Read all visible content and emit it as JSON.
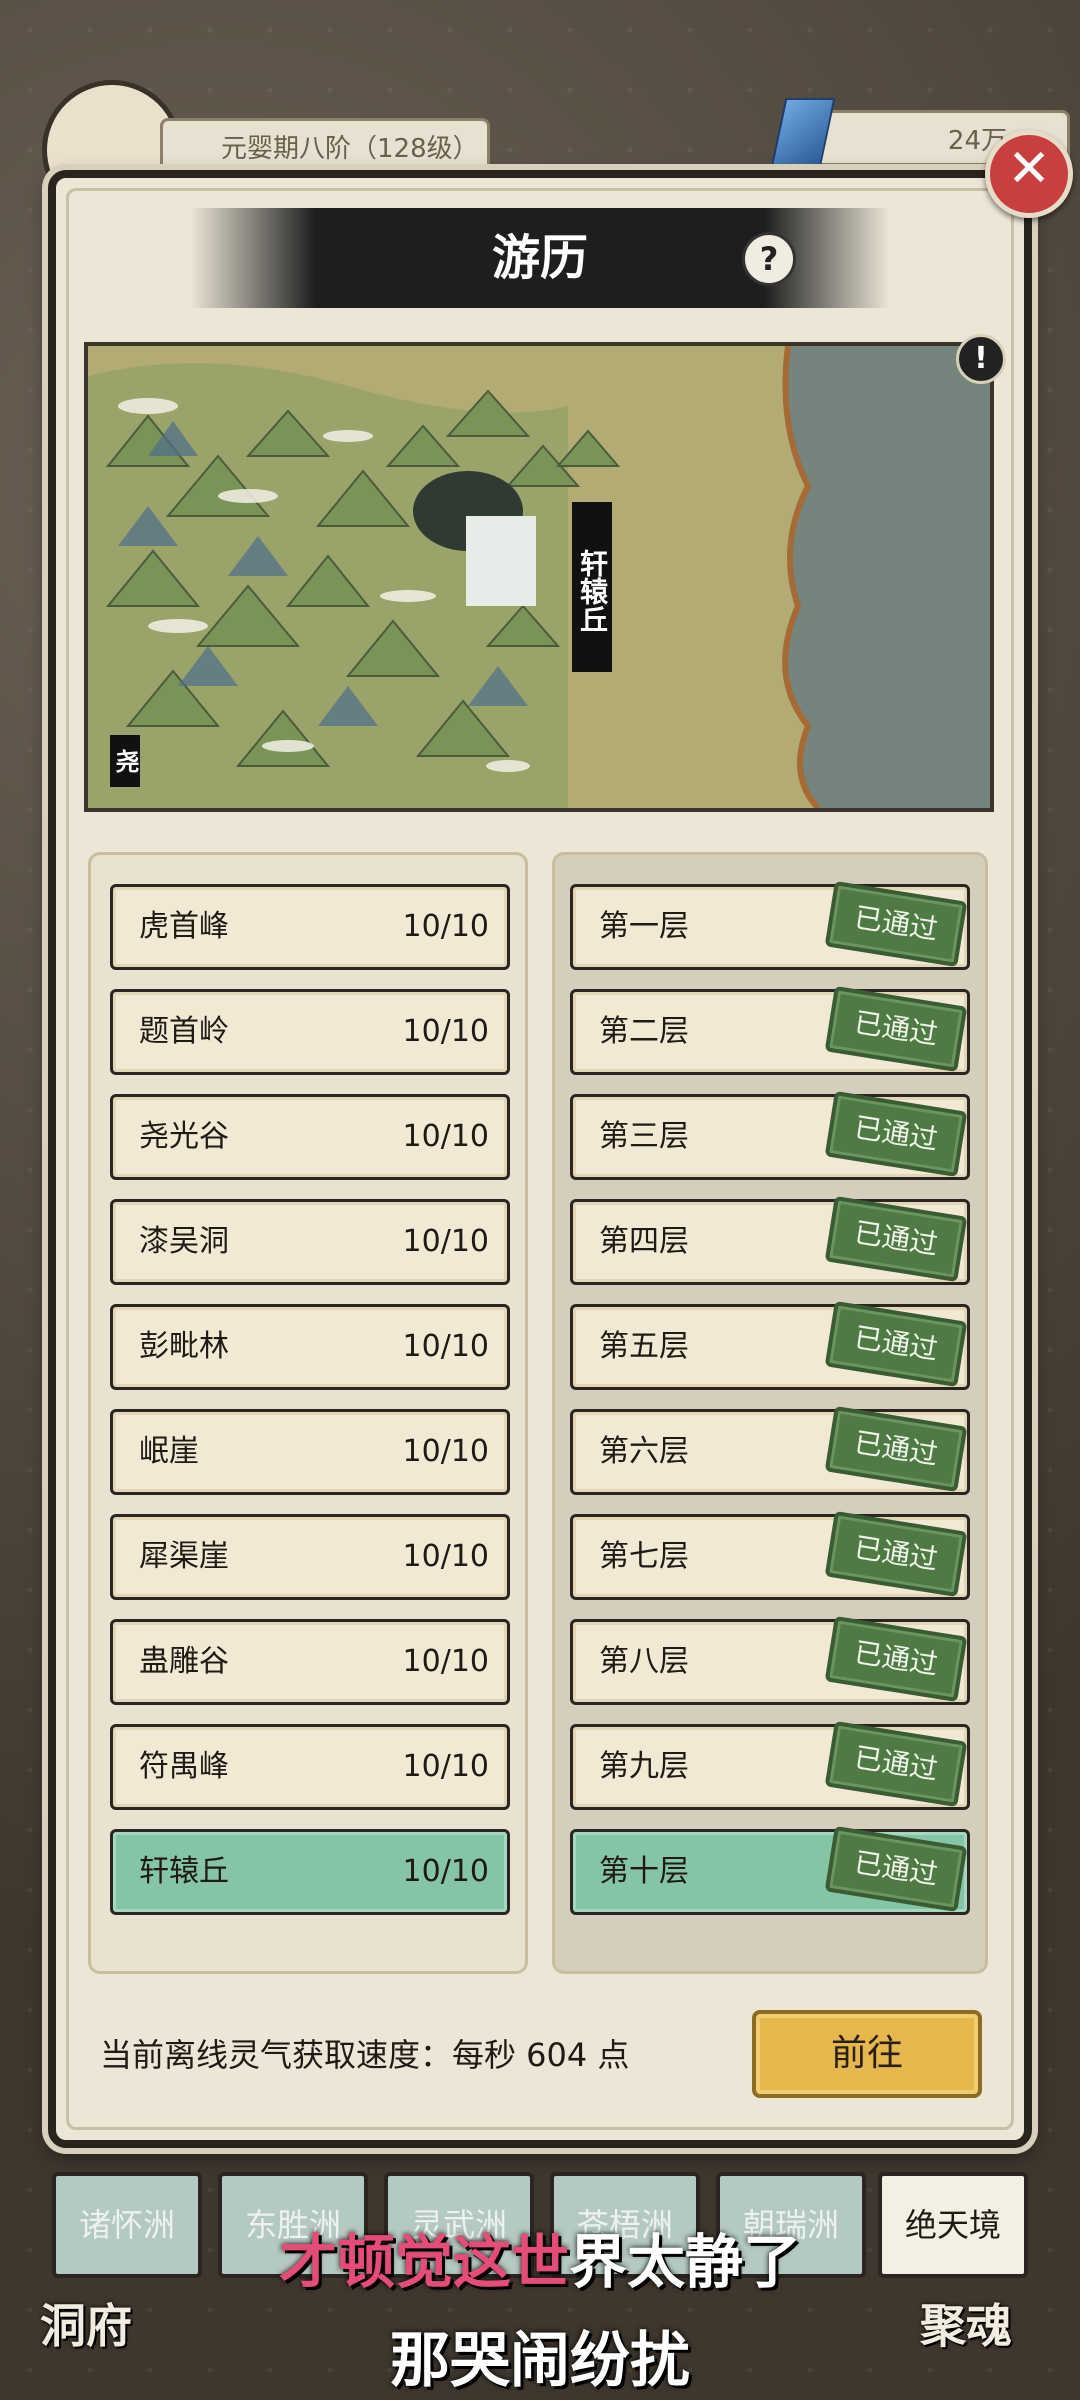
{
  "hud": {
    "level_text": "元婴期八阶（128级）",
    "currency_text": "24万",
    "icons": [
      "avatar",
      "gem-icon"
    ]
  },
  "dialog": {
    "title": "游历",
    "help_label": "?",
    "close_label": "✕",
    "alert_label": "!"
  },
  "map": {
    "label": "轩辕丘",
    "corner_label": "尧"
  },
  "regions": [
    {
      "name": "虎首峰",
      "progress": "10/10"
    },
    {
      "name": "题首岭",
      "progress": "10/10"
    },
    {
      "name": "尧光谷",
      "progress": "10/10"
    },
    {
      "name": "漆吴洞",
      "progress": "10/10"
    },
    {
      "name": "彭毗林",
      "progress": "10/10"
    },
    {
      "name": "岷崖",
      "progress": "10/10"
    },
    {
      "name": "犀渠崖",
      "progress": "10/10"
    },
    {
      "name": "蛊雕谷",
      "progress": "10/10"
    },
    {
      "name": "符禺峰",
      "progress": "10/10"
    },
    {
      "name": "轩辕丘",
      "progress": "10/10"
    }
  ],
  "floors": [
    {
      "name": "第一层",
      "status": "已通过"
    },
    {
      "name": "第二层",
      "status": "已通过"
    },
    {
      "name": "第三层",
      "status": "已通过"
    },
    {
      "name": "第四层",
      "status": "已通过"
    },
    {
      "name": "第五层",
      "status": "已通过"
    },
    {
      "name": "第六层",
      "status": "已通过"
    },
    {
      "name": "第七层",
      "status": "已通过"
    },
    {
      "name": "第八层",
      "status": "已通过"
    },
    {
      "name": "第九层",
      "status": "已通过"
    },
    {
      "name": "第十层",
      "status": "已通过"
    }
  ],
  "footer": {
    "rate_text": "当前离线灵气获取速度：每秒 604 点",
    "go_button": "前往"
  },
  "region_tabs": [
    {
      "label": "诸怀洲",
      "active": false
    },
    {
      "label": "东胜洲",
      "active": false
    },
    {
      "label": "灵武洲",
      "active": false
    },
    {
      "label": "苍梧洲",
      "active": false
    },
    {
      "label": "朝瑞洲",
      "active": false
    },
    {
      "label": "绝天境",
      "active": true
    }
  ],
  "bottom_nav": {
    "left": "洞府",
    "right": "聚魂"
  },
  "subtitles": {
    "line1_highlight": "才顿觉这世",
    "line1_rest": "界太静了",
    "line2": "那哭闹纷扰"
  },
  "colors": {
    "selected_row": "#86c4a6",
    "stamp": "#4f7a44",
    "go_button": "#e6b74c",
    "close_button": "#c73f3f",
    "subtitle_highlight": "#e64c78"
  }
}
